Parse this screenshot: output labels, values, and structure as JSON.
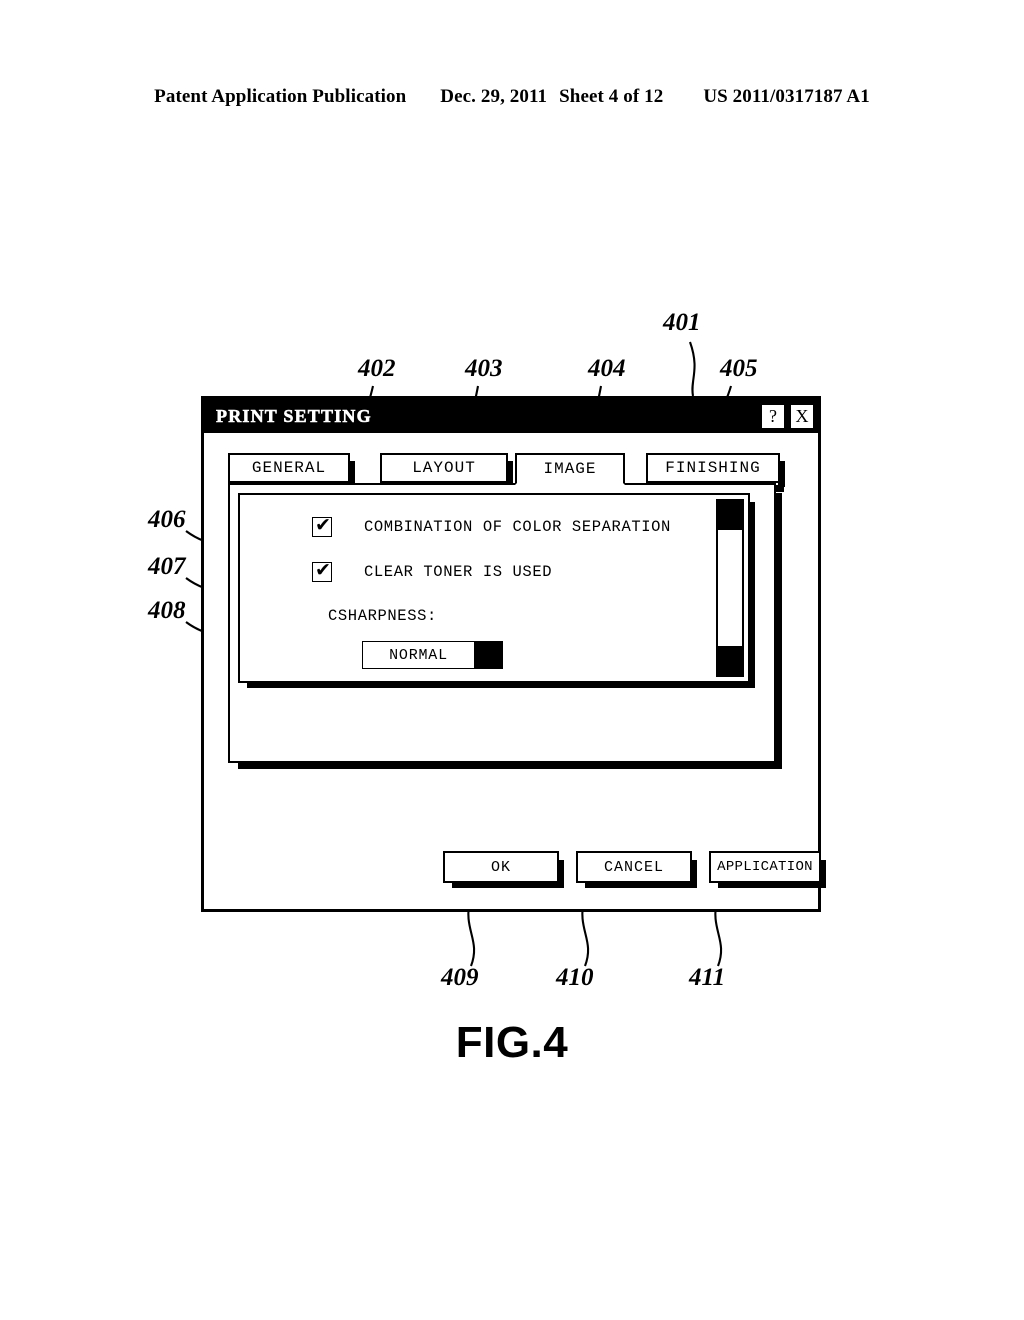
{
  "page_header": {
    "publication": "Patent Application Publication",
    "date": "Dec. 29, 2011",
    "sheet": "Sheet 4 of 12",
    "patent_number": "US 2011/0317187 A1"
  },
  "figure": {
    "caption": "FIG.4"
  },
  "dialog": {
    "title": "PRINT SETTING",
    "help_button": "?",
    "close_button": "X",
    "tabs": [
      {
        "label": "GENERAL",
        "active": false,
        "ref": "402"
      },
      {
        "label": "LAYOUT",
        "active": false,
        "ref": "403"
      },
      {
        "label": "IMAGE",
        "active": true,
        "ref": "404"
      },
      {
        "label": "FINISHING",
        "active": false,
        "ref": "405"
      }
    ],
    "settings": {
      "checkboxes": [
        {
          "label": "COMBINATION OF COLOR SEPARATION",
          "checked": true,
          "tick": "✔",
          "ref": "406"
        },
        {
          "label": "CLEAR TONER IS USED",
          "checked": true,
          "tick": "✔",
          "ref": "407"
        }
      ],
      "sharpness": {
        "label": "CSHARPNESS:",
        "value": "NORMAL",
        "ref": "408"
      }
    },
    "buttons": [
      {
        "label": "OK",
        "ref": "409"
      },
      {
        "label": "CANCEL",
        "ref": "410"
      },
      {
        "label": "APPLICATION",
        "ref": "411"
      }
    ]
  },
  "callouts": {
    "c401": "401",
    "c402": "402",
    "c403": "403",
    "c404": "404",
    "c405": "405",
    "c406": "406",
    "c407": "407",
    "c408": "408",
    "c409": "409",
    "c410": "410",
    "c411": "411"
  },
  "colors": {
    "ink": "#000000",
    "paper": "#ffffff"
  }
}
